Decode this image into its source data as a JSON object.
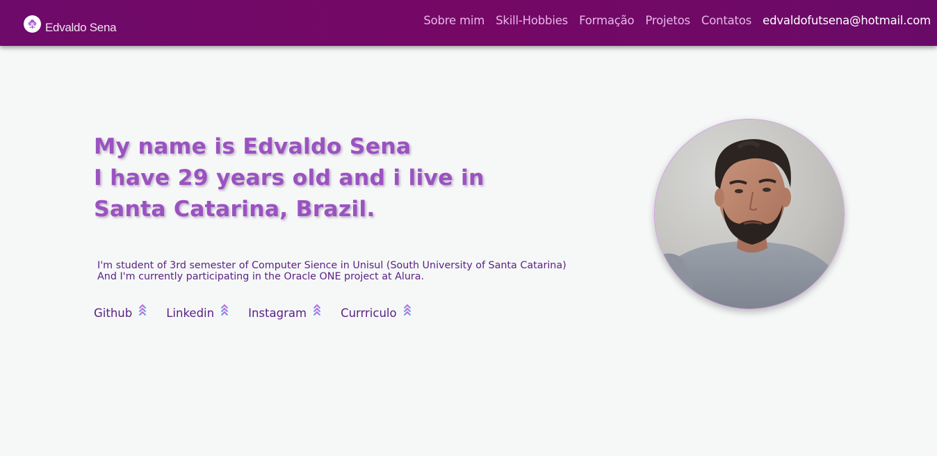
{
  "brand": {
    "name": "Edvaldo Sena",
    "logo_icon": "flower-logo-icon"
  },
  "nav": {
    "items": [
      {
        "label": "Sobre mim"
      },
      {
        "label": "Skill-Hobbies"
      },
      {
        "label": "Formação"
      },
      {
        "label": "Projetos"
      },
      {
        "label": "Contatos"
      }
    ],
    "email": "edvaldofutsena@hotmail.com"
  },
  "hero": {
    "title_lines": [
      "My name is Edvaldo Sena",
      "I have 29 years old and i live in",
      "Santa Catarina, Brazil."
    ],
    "bio_lines": [
      "I'm student of 3rd semester of Computer Sience in Unisul (South University of Santa Catarina)",
      "And I'm currently participating in the Oracle ONE project at Alura."
    ]
  },
  "social": [
    {
      "label": "Github",
      "icon": "double-chevron-up-icon"
    },
    {
      "label": "Linkedin",
      "icon": "double-chevron-up-icon"
    },
    {
      "label": "Instagram",
      "icon": "double-chevron-up-icon"
    },
    {
      "label": "Currriculo",
      "icon": "double-chevron-up-icon"
    }
  ],
  "profile_photo": {
    "icon": "profile-photo"
  },
  "colors": {
    "navbar_bg": "#740867",
    "nav_link": "#e8b8ea",
    "page_bg": "#f6f8f8",
    "title": "#9b52c0",
    "body_text": "#5a2184",
    "avatar_border": "#d29be0"
  }
}
